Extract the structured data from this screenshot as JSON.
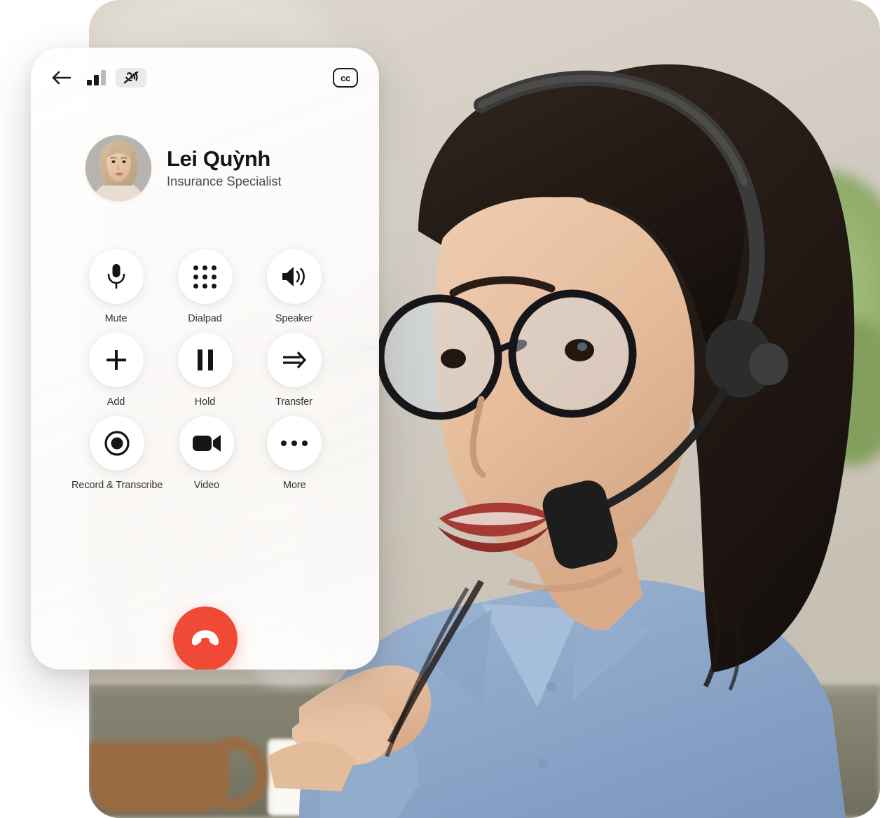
{
  "screen": {
    "type": "mobile-call-screen",
    "accent_red": "#f04a36",
    "text_primary": "#151515",
    "text_secondary": "#4e4e4e",
    "card_background": "#ffffff"
  },
  "status_bar": {
    "back_label": "Back",
    "back_icon": "arrow-left-icon",
    "signal_icon": "signal-bars-icon",
    "signal_bars_filled": 2,
    "signal_bars_total": 3,
    "mute_icon": "microphone-muted-icon",
    "cc_label": "cc",
    "cc_icon": "closed-captions-icon"
  },
  "contact": {
    "avatar_icon": "avatar-photo",
    "name": "Lei Quỳnh",
    "role": "Insurance Specialist"
  },
  "controls": {
    "rows": [
      [
        {
          "id": "mute",
          "label": "Mute",
          "icon": "microphone-icon"
        },
        {
          "id": "dialpad",
          "label": "Dialpad",
          "icon": "dialpad-icon"
        },
        {
          "id": "speaker",
          "label": "Speaker",
          "icon": "speaker-icon"
        }
      ],
      [
        {
          "id": "add",
          "label": "Add",
          "icon": "plus-icon"
        },
        {
          "id": "hold",
          "label": "Hold",
          "icon": "pause-icon"
        },
        {
          "id": "transfer",
          "label": "Transfer",
          "icon": "arrow-right-double-icon"
        }
      ],
      [
        {
          "id": "record",
          "label": "Record & Transcribe",
          "icon": "record-circle-icon"
        },
        {
          "id": "video",
          "label": "Video",
          "icon": "video-camera-icon"
        },
        {
          "id": "more",
          "label": "More",
          "icon": "ellipsis-icon"
        }
      ]
    ]
  },
  "end_call": {
    "label": "End call",
    "icon": "phone-hangup-icon",
    "color": "#f04a36"
  },
  "photo": {
    "description": "Call center agent wearing headset"
  }
}
